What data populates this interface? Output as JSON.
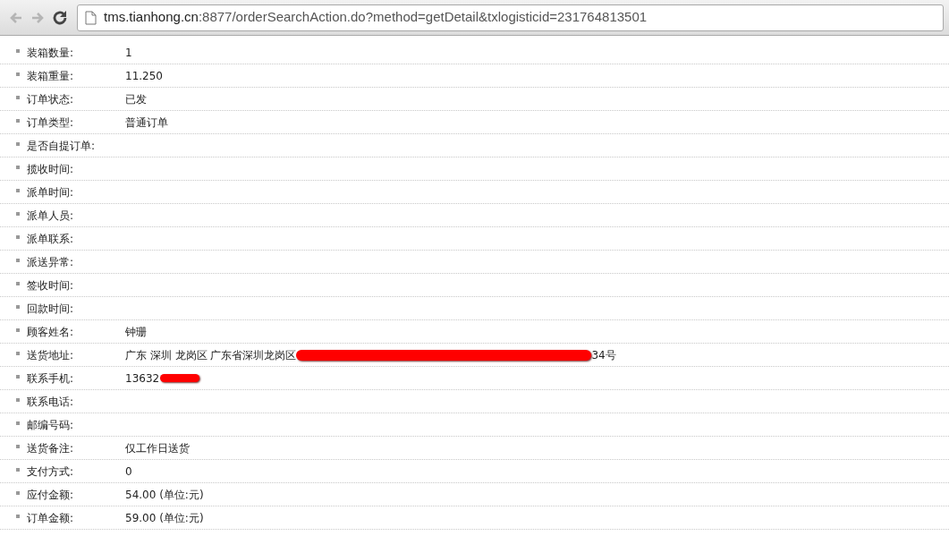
{
  "toolbar": {
    "back_disabled": true,
    "forward_disabled": true,
    "url_host": "tms.tianhong.cn",
    "url_rest": ":8877/orderSearchAction.do?method=getDetail&txlogisticid=231764813501"
  },
  "fields": [
    {
      "label": "装箱数量:",
      "value": "1"
    },
    {
      "label": "装箱重量:",
      "value": "11.250"
    },
    {
      "label": "订单状态:",
      "value": "已发"
    },
    {
      "label": "订单类型:",
      "value": "普通订单"
    },
    {
      "label": "是否自提订单:"
    },
    {
      "label": "揽收时间:"
    },
    {
      "label": "派单时间:"
    },
    {
      "label": "派单人员:"
    },
    {
      "label": "派单联系:"
    },
    {
      "label": "派送异常:"
    },
    {
      "label": "签收时间:"
    },
    {
      "label": "回款时间:"
    },
    {
      "label": "顾客姓名:",
      "value": "钟珊"
    },
    {
      "label": "送货地址:",
      "value": "广东 深圳 龙岗区 广东省深圳龙岗区",
      "redacted": true,
      "value_end": "34号"
    },
    {
      "label": "联系手机:",
      "value": "13632",
      "redacted": true
    },
    {
      "label": "联系电话:"
    },
    {
      "label": "邮编号码:"
    },
    {
      "label": "送货备注:",
      "value": "仅工作日送货"
    },
    {
      "label": "支付方式:",
      "value": "0"
    },
    {
      "label": "应付金额:",
      "value": "54.00 (单位:元)"
    },
    {
      "label": "订单金额:",
      "value": "59.00 (单位:元)"
    }
  ]
}
